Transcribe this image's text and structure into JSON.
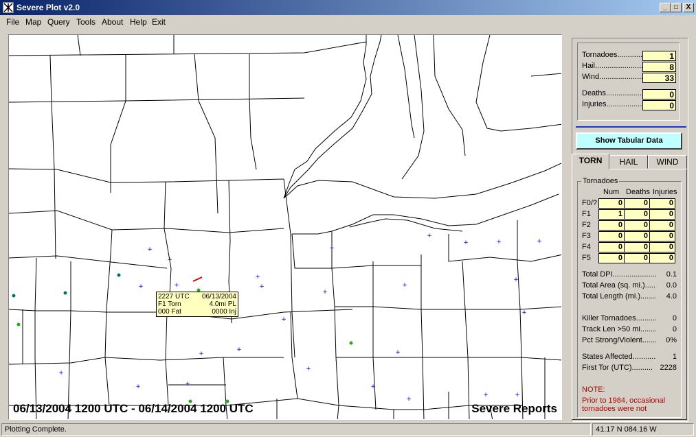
{
  "window": {
    "title": "Severe Plot v2.0",
    "minimize": "_",
    "maximize": "□",
    "close": "X"
  },
  "menu": [
    "File",
    "Map",
    "Query",
    "Tools",
    "About",
    "Help",
    "Exit"
  ],
  "map": {
    "caption_left": "06/13/2004 1200 UTC - 06/14/2004 1200 UTC",
    "caption_right": "Severe Reports",
    "popup": {
      "time": "2227 UTC",
      "date": "06/13/2004",
      "type": "F1 Torn",
      "length": "4.0mi PL",
      "fatalities": "000 Fat",
      "injuries": "0000 Inj"
    },
    "colors": {
      "hail": "#22aa22",
      "wind": "#0000cc",
      "tornado": "#dd0000",
      "hail_teal": "#007070"
    }
  },
  "summary": {
    "tornadoes_label": "Tornadoes.............",
    "tornadoes": "1",
    "hail_label": "Hail........................",
    "hail": "8",
    "wind_label": "Wind......................",
    "wind": "33",
    "deaths_label": "Deaths....................",
    "deaths": "0",
    "injuries_label": "Injuries...................",
    "injuries": "0"
  },
  "show_tabular_button": "Show Tabular Data",
  "tabs": [
    {
      "label": "TORN"
    },
    {
      "label": "HAIL"
    },
    {
      "label": "WIND"
    }
  ],
  "torn_panel": {
    "group_title": "Tornadoes",
    "headers": [
      "Num",
      "Deaths",
      "Injuries"
    ],
    "rows": [
      {
        "label": "F0/?",
        "num": "0",
        "deaths": "0",
        "injuries": "0"
      },
      {
        "label": "F1",
        "num": "1",
        "deaths": "0",
        "injuries": "0"
      },
      {
        "label": "F2",
        "num": "0",
        "deaths": "0",
        "injuries": "0"
      },
      {
        "label": "F3",
        "num": "0",
        "deaths": "0",
        "injuries": "0"
      },
      {
        "label": "F4",
        "num": "0",
        "deaths": "0",
        "injuries": "0"
      },
      {
        "label": "F5",
        "num": "0",
        "deaths": "0",
        "injuries": "0"
      }
    ],
    "stats": [
      {
        "label": "Total DPI......................",
        "value": "0.1"
      },
      {
        "label": "Total Area (sq. mi.).........",
        "value": "0.0"
      },
      {
        "label": "Total Length (mi.).........",
        "value": "4.0"
      },
      {
        "label": "Killer Tornadoes..........",
        "value": "0"
      },
      {
        "label": "Track Len >50 mi.........",
        "value": "0"
      },
      {
        "label": "Pct Strong/Violent.......",
        "value": "0%"
      },
      {
        "label": "States Affected............",
        "value": "1"
      },
      {
        "label": "First Tor (UTC)..........",
        "value": "2228"
      }
    ],
    "note_title": "NOTE:",
    "note_text": "Prior to 1984, occasional tornadoes were not"
  },
  "status": {
    "message": "Plotting Complete.",
    "coords": "41.17 N   084.16 W"
  }
}
